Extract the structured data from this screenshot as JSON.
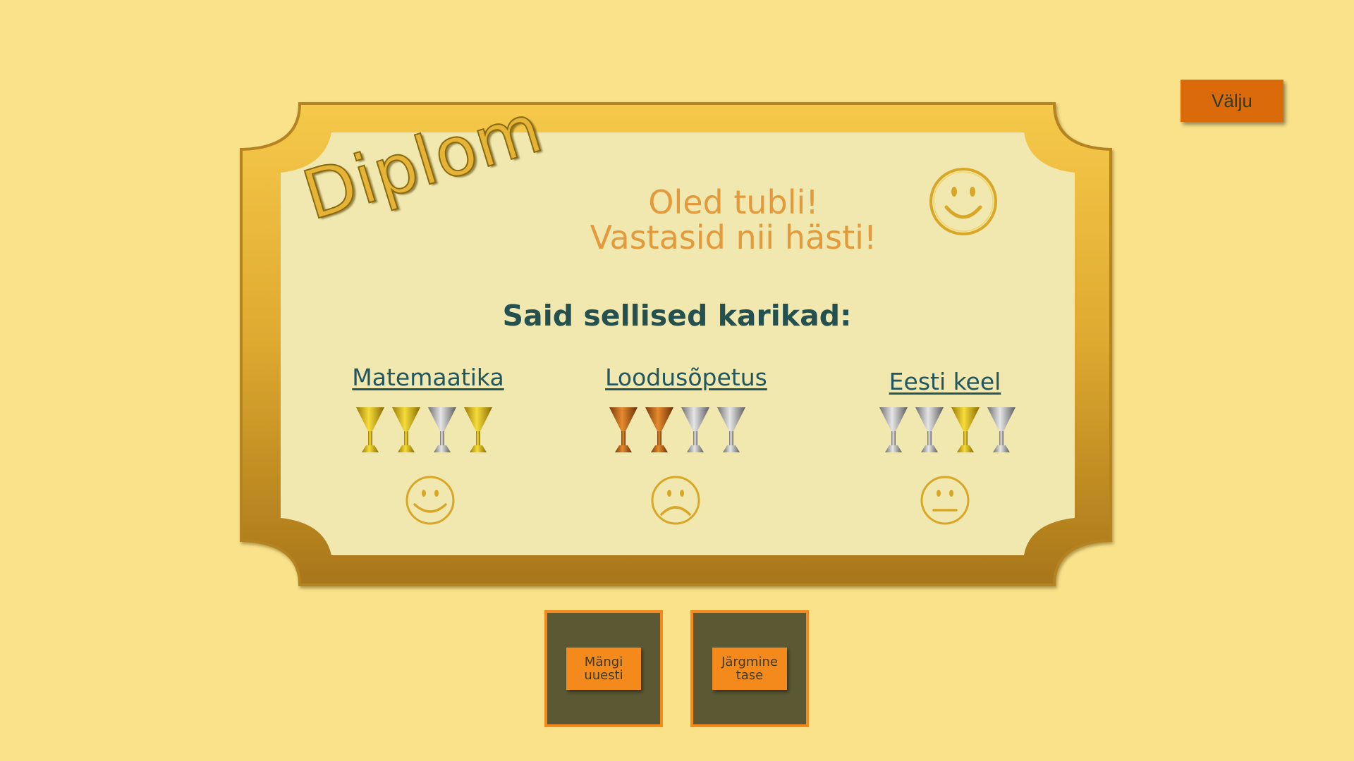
{
  "exit_button": {
    "label": "Välju"
  },
  "diploma": {
    "title": "Diplom",
    "praise_line1": "Oled tubli!",
    "praise_line2": "Vastasid nii hästi!",
    "main_mood": "happy-face-icon",
    "heading": "Said sellised karikad:"
  },
  "subjects": [
    {
      "title": "Matemaatika",
      "trophies": [
        "gold",
        "gold",
        "silver",
        "gold"
      ],
      "mood": "happy"
    },
    {
      "title": "Loodusõpetus",
      "trophies": [
        "bronze",
        "bronze",
        "silver",
        "silver"
      ],
      "mood": "sad"
    },
    {
      "title": "Eesti keel",
      "trophies": [
        "silver",
        "silver",
        "gold",
        "silver"
      ],
      "mood": "neutral"
    }
  ],
  "buttons": {
    "play_again": {
      "line1": "Mängi",
      "line2": "uuesti"
    },
    "next_level": {
      "line1": "Järgmine",
      "line2": "tase"
    }
  },
  "colors": {
    "background": "#FAE28A",
    "frame_gold": "#E4AF36",
    "paper": "#F0E8AE",
    "praise": "#E39A3C",
    "heading": "#245050",
    "subject_link": "#215660",
    "exit": "#DB6A0A",
    "button_orange": "#F58A1C",
    "button_dark": "#5A5933"
  }
}
